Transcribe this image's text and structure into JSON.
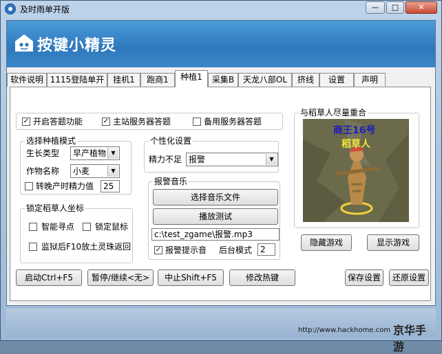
{
  "window": {
    "title": "及时雨单开版",
    "min_label": "—",
    "max_label": "□",
    "close_label": "✕"
  },
  "banner": {
    "logo_text": "按键小精灵"
  },
  "tabs": [
    {
      "label": "软件说明"
    },
    {
      "label": "1115登陆单开"
    },
    {
      "label": "挂机1"
    },
    {
      "label": "跑商1"
    },
    {
      "label": "种植1"
    },
    {
      "label": "采集B"
    },
    {
      "label": "天龙八部OL"
    },
    {
      "label": "挤线"
    },
    {
      "label": "设置"
    },
    {
      "label": "声明"
    }
  ],
  "top_options": {
    "answer": "开启答题功能",
    "main_server": "主站服务器答题",
    "backup_server": "备用服务器答题"
  },
  "planting_mode": {
    "title": "选择种植模式",
    "growth_type_label": "生长类型",
    "growth_type_value": "早产植物",
    "crop_name_label": "作物名称",
    "crop_name_value": "小麦",
    "late_energy_label": "转晚产时精力值",
    "late_energy_value": "25"
  },
  "lock_coords": {
    "title": "锁定稻草人坐标",
    "smart_path": "智能寻点",
    "lock_mouse": "锁定鼠标",
    "f10_label": "监狱后F10放土灵珠返回"
  },
  "personal": {
    "title": "个性化设置",
    "low_energy_label": "精力不足",
    "low_energy_value": "报警"
  },
  "alarm": {
    "title": "报警音乐",
    "choose_btn": "选择音乐文件",
    "play_btn": "播放测试",
    "file_path": "c:\\test_zgame\\报警.mp3",
    "alert_sound_label": "报警提示音",
    "bg_mode_label": "后台模式",
    "bg_mode_value": "2"
  },
  "scarecrow": {
    "title": "与稻草人尽量重合",
    "name_tag": "商王16号",
    "label": "稻草人"
  },
  "game_buttons": {
    "hide": "隐藏游戏",
    "show": "显示游戏"
  },
  "bottom_buttons": {
    "start": "启动Ctrl+F5",
    "pause": "暂停/继续<无>",
    "stop": "中止Shift+F5",
    "edit_hotkey": "修改热键",
    "save": "保存设置",
    "restore": "还原设置"
  },
  "footer": {
    "url": "http://www.hackhome.com",
    "watermark": "京华手游"
  }
}
